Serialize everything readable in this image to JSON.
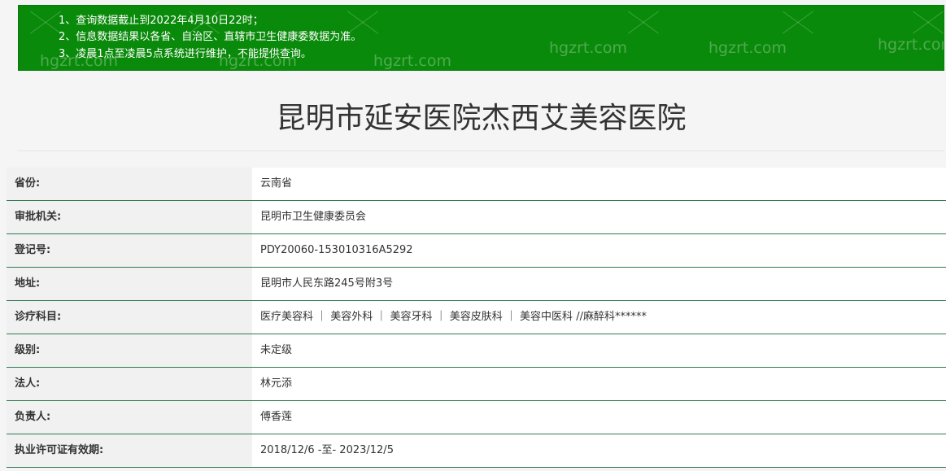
{
  "notice": {
    "lines": [
      "1、查询数据截止到2022年4月10日22时；",
      "2、信息数据结果以各省、自治区、直辖市卫生健康委数据为准。",
      "3、凌晨1点至凌晨5点系统进行维护，不能提供查询。"
    ],
    "watermark": "hgzrt.com",
    "background_color": "#0a8a0a"
  },
  "page": {
    "title": "昆明市延安医院杰西艾美容医院"
  },
  "info_rows": [
    {
      "label": "省份:",
      "value": "云南省"
    },
    {
      "label": "审批机关:",
      "value": "昆明市卫生健康委员会"
    },
    {
      "label": "登记号:",
      "value": "PDY20060-153010316A5292"
    },
    {
      "label": "地址:",
      "value": "昆明市人民东路245号附3号"
    },
    {
      "label": "诊疗科目:",
      "value": "医疗美容科 ｜ 美容外科 ｜ 美容牙科 ｜ 美容皮肤科 ｜ 美容中医科 //麻醉科******"
    },
    {
      "label": "级别:",
      "value": "未定级"
    },
    {
      "label": "法人:",
      "value": "林元添"
    },
    {
      "label": "负责人:",
      "value": "傅香莲"
    },
    {
      "label": "执业许可证有效期:",
      "value": "2018/12/6 -至- 2023/12/5"
    }
  ],
  "colors": {
    "row_divider": "#2f7b52",
    "label_background": "#f1f1f1",
    "value_background": "#ffffff"
  }
}
